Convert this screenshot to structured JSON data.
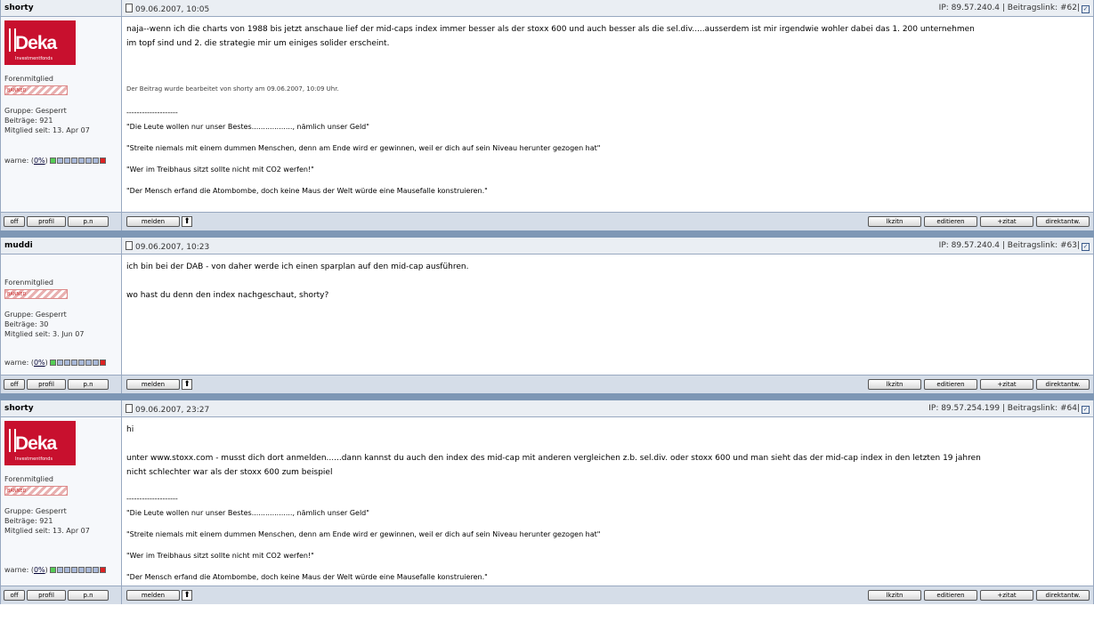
{
  "posts": [
    {
      "author": "shorty",
      "has_avatar": true,
      "avatar_text": "Deka",
      "avatar_sub": "Investmentfonds",
      "date": "09.06.2007, 10:05",
      "meta": "IP: 89.57.240.4 | Beitragslink: #62|",
      "rank": "Forenmitglied",
      "banned": "BANNED",
      "group": "Gruppe: Gesperrt",
      "posts": "Beiträge: 921",
      "member_since": "Mitglied seit: 13. Apr 07",
      "warn_label": "warne: (",
      "warn_value": "0%",
      "warn_close": ")",
      "lines": [
        "naja--wenn ich die charts von 1988 bis jetzt anschaue lief der mid-caps index immer besser als der stoxx 600 und auch besser als die sel.div.....ausserdem ist mir irgendwie wohler dabei das 1. 200 unternehmen",
        "im topf sind und 2. die strategie mir um einiges solider erscheint."
      ],
      "edited": "Der Beitrag wurde bearbeitet von shorty am 09.06.2007, 10:09 Uhr."
    },
    {
      "author": "muddi",
      "has_avatar": false,
      "date": "09.06.2007, 10:23",
      "meta": "IP: 89.57.240.4 | Beitragslink: #63|",
      "rank": "Forenmitglied",
      "banned": "BANNED",
      "group": "Gruppe: Gesperrt",
      "posts": "Beiträge: 30",
      "member_since": "Mitglied seit: 3. Jun 07",
      "warn_label": "warne: (",
      "warn_value": "0%",
      "warn_close": ")",
      "lines": [
        "ich bin bei der DAB - von daher werde ich einen sparplan auf den mid-cap ausführen.",
        "",
        "wo hast du denn den index nachgeschaut, shorty?"
      ]
    },
    {
      "author": "shorty",
      "has_avatar": true,
      "avatar_text": "Deka",
      "avatar_sub": "Investmentfonds",
      "date": "09.06.2007, 23:27",
      "meta": "IP: 89.57.254.199 | Beitragslink: #64|",
      "rank": "Forenmitglied",
      "banned": "BANNED",
      "group": "Gruppe: Gesperrt",
      "posts": "Beiträge: 921",
      "member_since": "Mitglied seit: 13. Apr 07",
      "warn_label": "warne: (",
      "warn_value": "0%",
      "warn_close": ")",
      "lines": [
        "hi",
        "",
        "unter www.stoxx.com - musst dich dort anmelden......dann kannst du auch den index des mid-cap mit anderen vergleichen z.b. sel.div. oder stoxx 600 und man sieht das der mid-cap index in den letzten 19 jahren",
        "nicht schlechter war als der stoxx 600 zum beispiel"
      ]
    }
  ],
  "signature": {
    "dash": "--------------------",
    "lines": [
      "\"Die Leute wollen nur unser Bestes.................., nämlich unser Geld\"",
      "\"Streite niemals mit einem dummen Menschen, denn am Ende wird er gewinnen, weil er dich auf sein Niveau herunter gezogen hat\"",
      "\"Wer im Treibhaus sitzt sollte nicht mit CO2 werfen!\"",
      "\"Der Mensch erfand die Atombombe, doch keine Maus der Welt würde eine Mausefalle konstruieren.\""
    ]
  },
  "buttons": {
    "off": "off",
    "profil": "profil",
    "pn": "p.n",
    "melden": "melden",
    "up": "⬆",
    "zitieren_list": "lkzitn",
    "editieren": "editieren",
    "zitat": "+zitat",
    "direktantw": "direktantw."
  }
}
